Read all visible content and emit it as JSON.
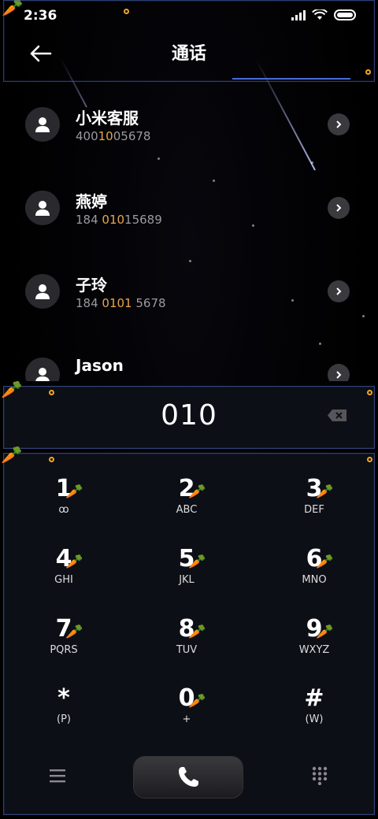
{
  "status": {
    "time": "2:36"
  },
  "header": {
    "title": "通话"
  },
  "contacts": [
    {
      "name": "小米客服",
      "num_pre": "400",
      "num_hl": "1",
      "num_hl2": "0",
      "num_post": "05678",
      "num_full_a": "400",
      "num_full_b": "10",
      "num_full_c": "05678"
    },
    {
      "name": "燕婷",
      "num_a": "184 ",
      "num_b": "010",
      "num_c": "15689"
    },
    {
      "name": "子玲",
      "num_a": "184 ",
      "num_b": "0101",
      "num_c": " 5678"
    },
    {
      "name": "Jason"
    }
  ],
  "display": {
    "digits": "010"
  },
  "keys": [
    {
      "digit": "1",
      "letters": "ꝏ"
    },
    {
      "digit": "2",
      "letters": "ABC"
    },
    {
      "digit": "3",
      "letters": "DEF"
    },
    {
      "digit": "4",
      "letters": "GHI"
    },
    {
      "digit": "5",
      "letters": "JKL"
    },
    {
      "digit": "6",
      "letters": "MNO"
    },
    {
      "digit": "7",
      "letters": "PQRS"
    },
    {
      "digit": "8",
      "letters": "TUV"
    },
    {
      "digit": "9",
      "letters": "WXYZ"
    },
    {
      "digit": "*",
      "letters": "(P)"
    },
    {
      "digit": "0",
      "letters": "+"
    },
    {
      "digit": "#",
      "letters": "(W)"
    }
  ],
  "colors": {
    "highlight": "#e8a64a",
    "frame": "#4a6ad8",
    "accent_dot": "#f2a623"
  },
  "icons": {
    "decoration": "🥕"
  }
}
